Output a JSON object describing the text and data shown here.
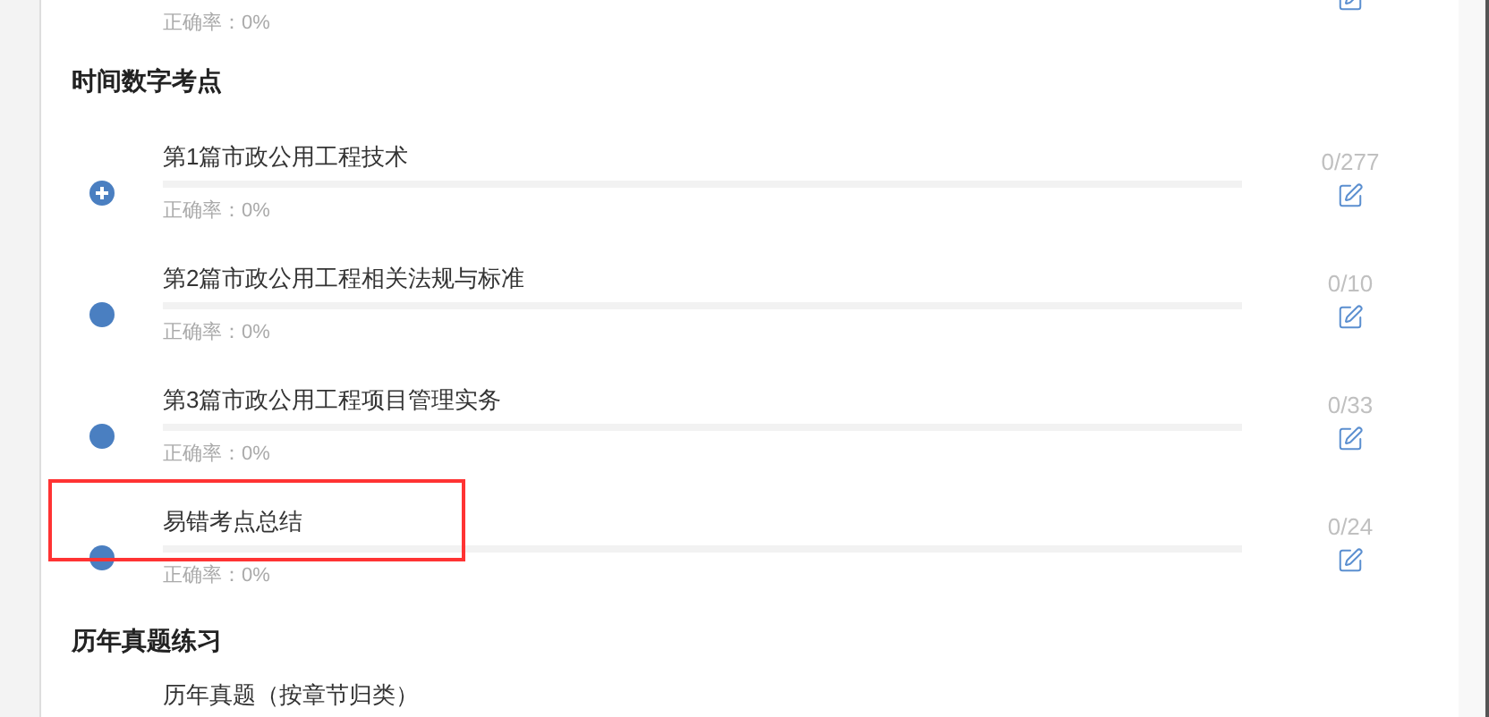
{
  "top_partial": {
    "accuracy": "正确率：0%"
  },
  "sections": [
    {
      "heading": "时间数字考点",
      "items": [
        {
          "kind": "expandable",
          "title": "第1篇市政公用工程技术",
          "accuracy": "正确率：0%",
          "count": "0/277",
          "highlighted": false
        },
        {
          "kind": "dot",
          "title": "第2篇市政公用工程相关法规与标准",
          "accuracy": "正确率：0%",
          "count": "0/10",
          "highlighted": false
        },
        {
          "kind": "dot",
          "title": "第3篇市政公用工程项目管理实务",
          "accuracy": "正确率：0%",
          "count": "0/33",
          "highlighted": false
        },
        {
          "kind": "dot",
          "title": "易错考点总结",
          "accuracy": "正确率：0%",
          "count": "0/24",
          "highlighted": true
        }
      ]
    },
    {
      "heading": "历年真题练习",
      "items": [
        {
          "kind": "partial",
          "title": "历年真题（按章节归类）"
        }
      ]
    }
  ]
}
